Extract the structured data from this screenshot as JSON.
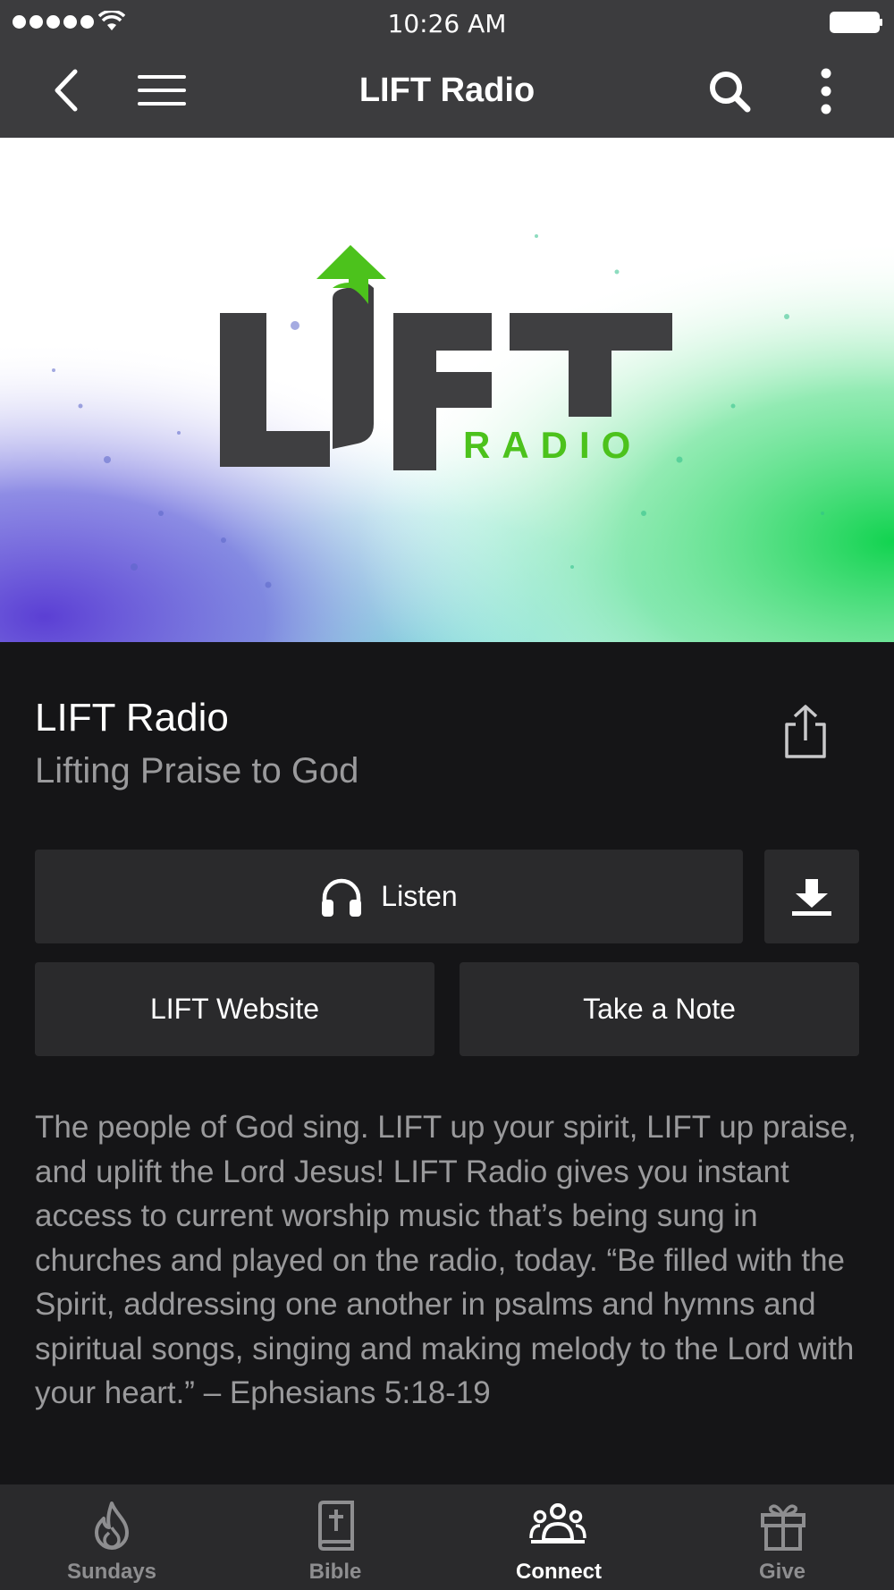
{
  "status_bar": {
    "time": "10:26 AM"
  },
  "nav": {
    "title": "LIFT Radio"
  },
  "hero": {
    "logo_text": "LIFT",
    "logo_sub": "RADIO",
    "brand_green": "#4cc21c",
    "logo_dark": "#3f3f41"
  },
  "content": {
    "title": "LIFT Radio",
    "subtitle": "Lifting Praise to God",
    "listen_label": "Listen",
    "website_label": "LIFT Website",
    "note_label": "Take a Note",
    "description": "The people of God sing. LIFT up your spirit, LIFT up praise, and uplift the Lord Jesus! LIFT Radio gives you instant access to current worship music that’s being sung in churches and played on the radio, today. “Be filled with the Spirit, addressing one another in psalms and hymns and spiritual songs, singing and making melody to the Lord with your heart.” – Ephesians 5:18-19"
  },
  "tabs": [
    {
      "label": "Sundays",
      "icon": "flame-icon",
      "active": false
    },
    {
      "label": "Bible",
      "icon": "bible-icon",
      "active": false
    },
    {
      "label": "Connect",
      "icon": "people-icon",
      "active": true
    },
    {
      "label": "Give",
      "icon": "gift-icon",
      "active": false
    }
  ],
  "colors": {
    "background": "#151517",
    "bar": "#3c3c3e",
    "button": "#2a2a2c",
    "muted_text": "#9a9a9c"
  }
}
